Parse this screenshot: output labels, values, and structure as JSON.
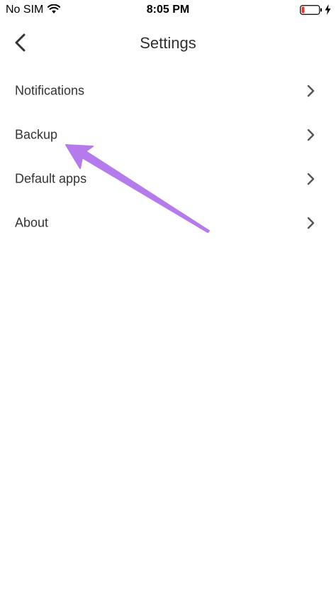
{
  "status_bar": {
    "carrier": "No SIM",
    "time": "8:05 PM",
    "battery_color": "#e53935"
  },
  "header": {
    "title": "Settings",
    "back_icon": "chevron-left-icon"
  },
  "settings": {
    "items": [
      {
        "label": "Notifications"
      },
      {
        "label": "Backup"
      },
      {
        "label": "Default apps"
      },
      {
        "label": "About"
      }
    ],
    "chevron_icon": "chevron-right-icon"
  },
  "annotation": {
    "arrow_color": "#b57bec",
    "points_to": "Backup"
  }
}
